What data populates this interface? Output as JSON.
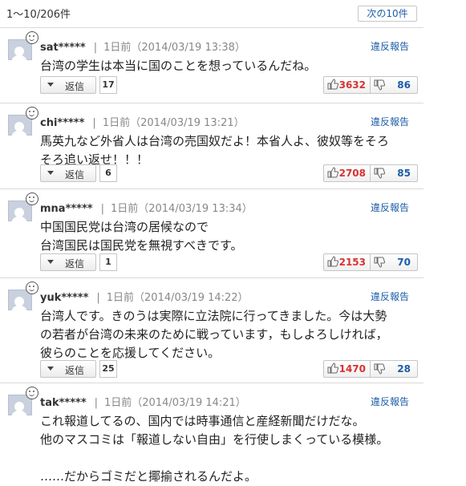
{
  "header": {
    "range": "1～10/206件",
    "next_label": "次の10件"
  },
  "labels": {
    "reply": "返信",
    "report": "違反報告"
  },
  "colors": {
    "link": "#1d5da8",
    "good": "#d83232",
    "bad": "#1d5da8"
  },
  "comments": [
    {
      "user": "sat*****",
      "time": "1日前（2014/03/19 13:38）",
      "body": "台湾の学生は本当に国のことを想っているんだね。",
      "replies": "17",
      "good": "3632",
      "bad": "86"
    },
    {
      "user": "chi*****",
      "time": "1日前（2014/03/19 13:21）",
      "body": "馬英九など外省人は台湾の売国奴だよ！本省人よ、彼奴等をそろ\nそろ追い返せ！！！",
      "replies": "6",
      "good": "2708",
      "bad": "85"
    },
    {
      "user": "mna*****",
      "time": "1日前（2014/03/19 13:34）",
      "body": "中国国民党は台湾の居候なので\n台湾国民は国民党を無視すべきです。",
      "replies": "1",
      "good": "2153",
      "bad": "70"
    },
    {
      "user": "yuk*****",
      "time": "1日前（2014/03/19 14:22）",
      "body": "台湾人です。きのうは実際に立法院に行ってきました。今は大勢\nの若者が台湾の未来のために戦っています，もしよろしければ，\n彼らのことを応援してください。",
      "replies": "25",
      "good": "1470",
      "bad": "28"
    },
    {
      "user": "tak*****",
      "time": "1日前（2014/03/19 14:21）",
      "body": "これ報道してるの、国内では時事通信と産経新聞だけだな。\n他のマスコミは「報道しない自由」を行使しまくっている模様。\n\n……だからゴミだと揶揄されるんだよ。",
      "replies": "",
      "good": "",
      "bad": ""
    }
  ]
}
